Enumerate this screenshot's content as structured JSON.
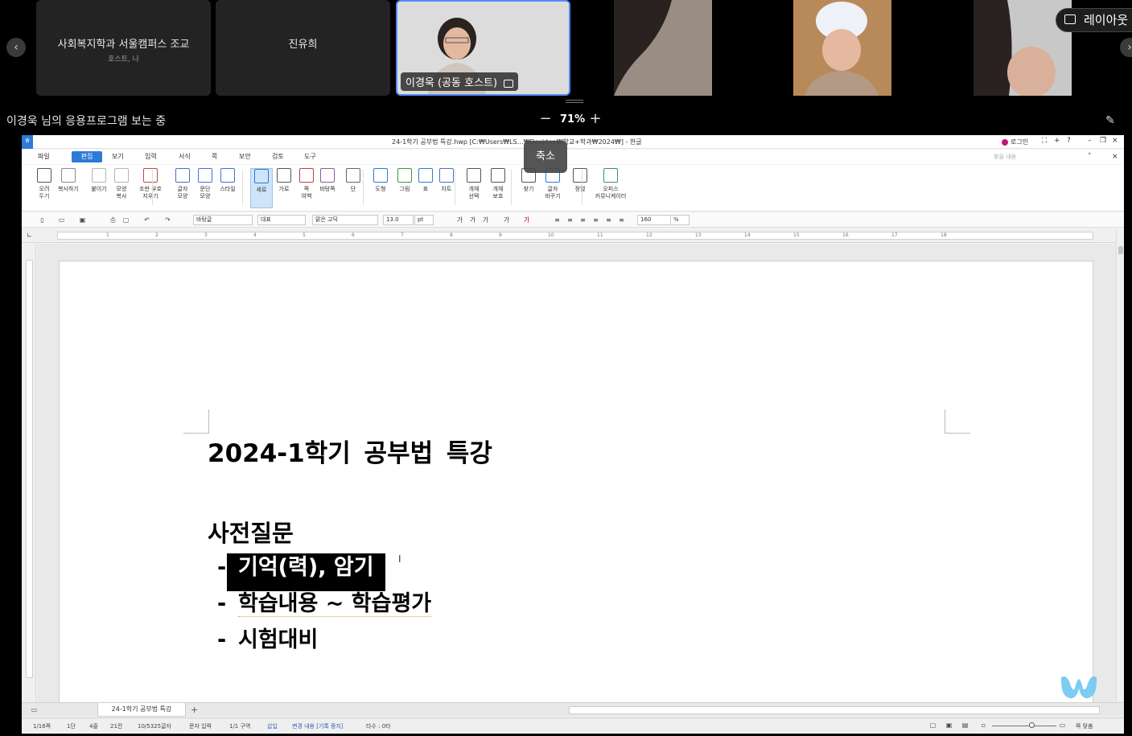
{
  "participants": [
    {
      "name": "사회복지학과 서울캠퍼스 조교",
      "subtitle": "호스트, 나"
    },
    {
      "name": "진유희"
    },
    {
      "video_label": "이경욱 (공동 호스트)"
    }
  ],
  "layout_label": "레이아웃",
  "share": {
    "viewing_text": "이경욱 님의 응용프로그램 보는 중",
    "zoom": "71%",
    "tooltip": "축소"
  },
  "app": {
    "title": "24-1학기 공부법 특강.hwp [C:₩Users₩LS…₩Desktop₩학교+학과₩2024₩] - 한글",
    "login": "로그인",
    "search_hint": "찾을 내용",
    "menus": [
      "파일",
      "편집",
      "보기",
      "입력",
      "서식",
      "쪽",
      "보안",
      "검토",
      "도구"
    ],
    "ribbon": [
      {
        "label": "오려\n두기"
      },
      {
        "label": "복사하기"
      },
      {
        "label": "붙이기"
      },
      {
        "label": "모양\n복사"
      },
      {
        "label": "조판 부호\n지우기"
      },
      {
        "label": "글자\n모양"
      },
      {
        "label": "문단\n모양"
      },
      {
        "label": "스타일"
      },
      {
        "label": "세로"
      },
      {
        "label": "가로"
      },
      {
        "label": "쪽\n여백"
      },
      {
        "label": "바탕쪽"
      },
      {
        "label": "단"
      },
      {
        "label": "도형"
      },
      {
        "label": "그림"
      },
      {
        "label": "표"
      },
      {
        "label": "차트"
      },
      {
        "label": "개체\n선택"
      },
      {
        "label": "개체\n보호"
      },
      {
        "label": "찾기"
      },
      {
        "label": "글자\n바꾸기"
      },
      {
        "label": "정렬"
      },
      {
        "label": "오피스\n커뮤니케이터"
      }
    ],
    "format": {
      "style": "바탕글",
      "lang": "대표",
      "font": "맑은 고딕",
      "size": "13.0",
      "unit": "pt",
      "zoom": "160",
      "zoom_unit": "%"
    },
    "ruler_ticks": [
      "1",
      "2",
      "3",
      "4",
      "5",
      "6",
      "7",
      "8",
      "9",
      "10",
      "11",
      "12",
      "13",
      "14",
      "15",
      "16",
      "17",
      "18"
    ],
    "doc": {
      "title": "2024-1학기 공부법 특강",
      "heading": "사전질문",
      "bullets": [
        "기억(력), 암기",
        "학습내용 ~ 학습평가",
        "시험대비"
      ]
    },
    "tab_name": "24-1학기 공부법 특강",
    "status": {
      "page": "1/16쪽",
      "col": "1단",
      "line": "4줄",
      "chars": "21칸",
      "count": "10/5325글자",
      "input": "문자 입력",
      "section": "1/1 구역",
      "mode": "삽입",
      "track": "변경 내용 [기록 중지]",
      "keys": "타수 : 0타",
      "fit": "쪽 맞춤"
    }
  }
}
